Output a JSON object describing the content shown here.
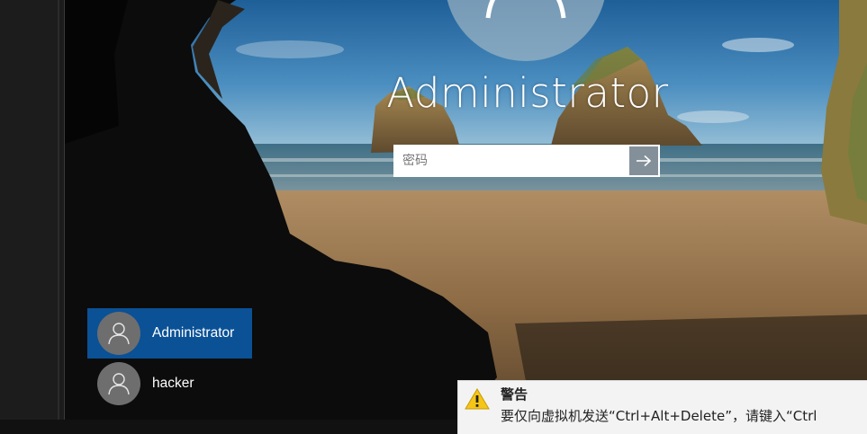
{
  "login": {
    "username": "Administrator",
    "password_placeholder": "密码"
  },
  "user_list": [
    {
      "name": "Administrator",
      "selected": true
    },
    {
      "name": "hacker",
      "selected": false
    }
  ],
  "warning": {
    "title": "警告",
    "message": "要仅向虚拟机发送“Ctrl+Alt+Delete”，请键入“Ctrl"
  },
  "colors": {
    "selected_user": "#0a5196",
    "submit_button": "#6e7d87",
    "warning_icon": "#f5c518"
  },
  "icons": {
    "submit": "arrow-right-icon",
    "user": "user-silhouette-icon",
    "warning": "warning-triangle-icon"
  }
}
